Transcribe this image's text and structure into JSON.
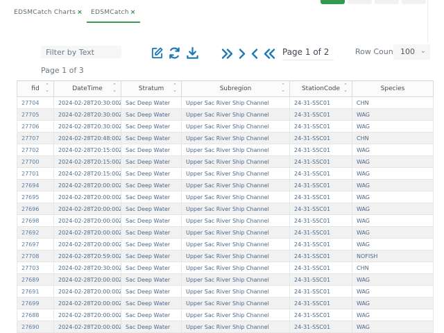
{
  "tabs": [
    {
      "label": "EDSMCatch Charts",
      "close": "×",
      "active": false
    },
    {
      "label": "EDSMCatch",
      "close": "×",
      "active": true
    }
  ],
  "toolbar": {
    "filter_placeholder": "Filter by Text",
    "page_info_small": "Page 1 of 3",
    "pager_label": "Page 1 of 2",
    "row_count_label": "Row Count",
    "row_count_value": "100",
    "icons": [
      "edit-icon",
      "refresh-icon",
      "download-icon",
      "last-page-icon",
      "next-page-icon",
      "previous-page-icon",
      "first-page-icon"
    ]
  },
  "colors": {
    "accent": "#1e79b5",
    "tab_active": "#3a9a56",
    "top_button": "#2e9b4e"
  },
  "table": {
    "columns": [
      "fid",
      "DateTime",
      "Stratum",
      "Subregion",
      "StationCode",
      "Species"
    ],
    "rows": [
      [
        "27704",
        "2024-02-28T20:30:00Z",
        "Sac Deep Water",
        "Upper Sac River Ship Channel",
        "24-31-SSC01",
        "CHN"
      ],
      [
        "27705",
        "2024-02-28T20:30:00Z",
        "Sac Deep Water",
        "Upper Sac River Ship Channel",
        "24-31-SSC01",
        "WAG"
      ],
      [
        "27706",
        "2024-02-28T20:30:00Z",
        "Sac Deep Water",
        "Upper Sac River Ship Channel",
        "24-31-SSC01",
        "WAG"
      ],
      [
        "27707",
        "2024-02-28T20:48:00Z",
        "Sac Deep Water",
        "Upper Sac River Ship Channel",
        "24-31-SSC01",
        "CHN"
      ],
      [
        "27702",
        "2024-02-28T20:15:00Z",
        "Sac Deep Water",
        "Upper Sac River Ship Channel",
        "24-31-SSC01",
        "WAG"
      ],
      [
        "27700",
        "2024-02-28T20:15:00Z",
        "Sac Deep Water",
        "Upper Sac River Ship Channel",
        "24-31-SSC01",
        "WAG"
      ],
      [
        "27701",
        "2024-02-28T20:15:00Z",
        "Sac Deep Water",
        "Upper Sac River Ship Channel",
        "24-31-SSC01",
        "WAG"
      ],
      [
        "27694",
        "2024-02-28T20:00:00Z",
        "Sac Deep Water",
        "Upper Sac River Ship Channel",
        "24-31-SSC01",
        "WAG"
      ],
      [
        "27695",
        "2024-02-28T20:00:00Z",
        "Sac Deep Water",
        "Upper Sac River Ship Channel",
        "24-31-SSC01",
        "WAG"
      ],
      [
        "27696",
        "2024-02-28T20:00:00Z",
        "Sac Deep Water",
        "Upper Sac River Ship Channel",
        "24-31-SSC01",
        "WAG"
      ],
      [
        "27698",
        "2024-02-28T20:00:00Z",
        "Sac Deep Water",
        "Upper Sac River Ship Channel",
        "24-31-SSC01",
        "WAG"
      ],
      [
        "27692",
        "2024-02-28T20:00:00Z",
        "Sac Deep Water",
        "Upper Sac River Ship Channel",
        "24-31-SSC01",
        "WAG"
      ],
      [
        "27697",
        "2024-02-28T20:00:00Z",
        "Sac Deep Water",
        "Upper Sac River Ship Channel",
        "24-31-SSC01",
        "WAG"
      ],
      [
        "27708",
        "2024-02-28T20:59:00Z",
        "Sac Deep Water",
        "Upper Sac River Ship Channel",
        "24-31-SSC01",
        "NOFISH"
      ],
      [
        "27703",
        "2024-02-28T20:30:00Z",
        "Sac Deep Water",
        "Upper Sac River Ship Channel",
        "24-31-SSC01",
        "CHN"
      ],
      [
        "27689",
        "2024-02-28T20:00:00Z",
        "Sac Deep Water",
        "Upper Sac River Ship Channel",
        "24-31-SSC01",
        "WAG"
      ],
      [
        "27691",
        "2024-02-28T20:00:00Z",
        "Sac Deep Water",
        "Upper Sac River Ship Channel",
        "24-31-SSC01",
        "WAG"
      ],
      [
        "27699",
        "2024-02-28T20:00:00Z",
        "Sac Deep Water",
        "Upper Sac River Ship Channel",
        "24-31-SSC01",
        "WAG"
      ],
      [
        "27688",
        "2024-02-28T20:00:00Z",
        "Sac Deep Water",
        "Upper Sac River Ship Channel",
        "24-31-SSC01",
        "WAG"
      ],
      [
        "27690",
        "2024-02-28T20:00:00Z",
        "Sac Deep Water",
        "Upper Sac River Ship Channel",
        "24-31-SSC01",
        "WAG"
      ]
    ]
  }
}
